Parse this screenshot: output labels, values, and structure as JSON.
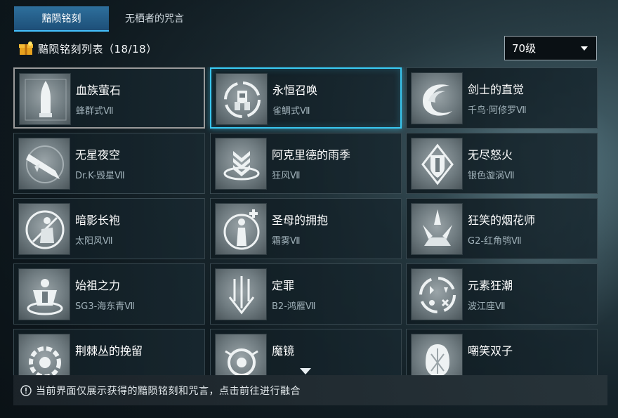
{
  "tabs": [
    {
      "label": "黯陨铭刻",
      "active": true
    },
    {
      "label": "无栖者的咒言",
      "active": false
    }
  ],
  "header": {
    "title": "黯陨铭刻列表（18/18）",
    "icon": "gift-icon"
  },
  "level_select": {
    "value": "70级"
  },
  "cards": [
    {
      "name": "血族萤石",
      "sub": "蜂群式Ⅶ",
      "icon": "bullet-emblem-icon"
    },
    {
      "name": "永恒召唤",
      "sub": "雀鲷式Ⅶ",
      "icon": "mech-summon-emblem-icon"
    },
    {
      "name": "剑士的直觉",
      "sub": "千鸟·阿修罗Ⅶ",
      "icon": "crescent-slash-emblem-icon"
    },
    {
      "name": "无星夜空",
      "sub": "Dr.K-毁星Ⅶ",
      "icon": "rocket-emblem-icon"
    },
    {
      "name": "阿克里德的雨季",
      "sub": "狂风Ⅶ",
      "icon": "chevron-down-emblem-icon"
    },
    {
      "name": "无尽怒火",
      "sub": "银色漩涡Ⅶ",
      "icon": "shield-emblem-icon"
    },
    {
      "name": "暗影长袍",
      "sub": "太阳风Ⅶ",
      "icon": "shadow-figure-emblem-icon"
    },
    {
      "name": "圣母的拥抱",
      "sub": "霜雾Ⅶ",
      "icon": "healing-figure-emblem-icon"
    },
    {
      "name": "狂笑的烟花师",
      "sub": "G2-红角鸮Ⅶ",
      "icon": "fireworks-emblem-icon"
    },
    {
      "name": "始祖之力",
      "sub": "SG3-海东青Ⅶ",
      "icon": "muscle-figure-emblem-icon"
    },
    {
      "name": "定罪",
      "sub": "B2-鸿雁Ⅶ",
      "icon": "falling-arrows-emblem-icon"
    },
    {
      "name": "元素狂潮",
      "sub": "波江座Ⅶ",
      "icon": "elements-cycle-emblem-icon"
    },
    {
      "name": "荆棘丛的挽留",
      "sub": "",
      "icon": "gear-ring-emblem-icon"
    },
    {
      "name": "魔镜",
      "sub": "",
      "icon": "mirror-gears-emblem-icon"
    },
    {
      "name": "嘲笑双子",
      "sub": "",
      "icon": "twin-gem-emblem-icon"
    }
  ],
  "info": {
    "text": "当前界面仅展示获得的黯陨铭刻和咒言，点击前往进行融合",
    "icon": "info-circle-icon"
  },
  "colors": {
    "tab_active": "#2e6f9c",
    "selected_border": "#39c7f0"
  }
}
